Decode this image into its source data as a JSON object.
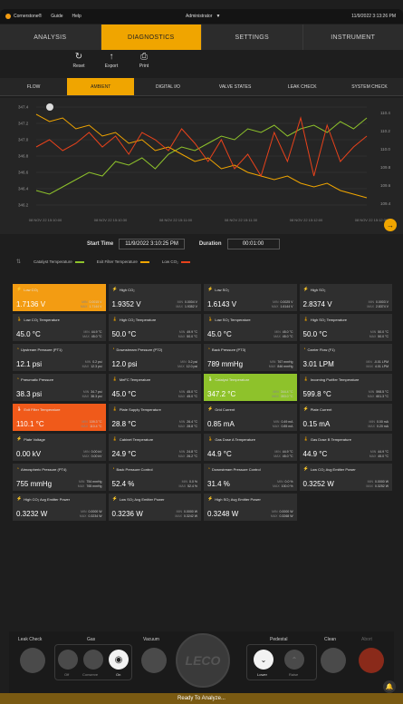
{
  "topbar": {
    "brand": "Cornerstone®",
    "guide": "Guide",
    "help": "Help",
    "user": "Administrator",
    "datetime": "11/9/2022 3:13:26 PM"
  },
  "main_tabs": [
    "ANALYSIS",
    "DIAGNOSTICS",
    "SETTINGS",
    "INSTRUMENT"
  ],
  "actions": [
    {
      "label": "Reset",
      "icon": "reset-icon",
      "glyph": "↻"
    },
    {
      "label": "Export",
      "icon": "export-icon",
      "glyph": "↑"
    },
    {
      "label": "Print",
      "icon": "print-icon",
      "glyph": "⎙"
    }
  ],
  "sub_tabs": [
    "FLOW",
    "AMBIENT",
    "DIGITAL I/O",
    "VALVE STATES",
    "LEAK CHECK",
    "SYSTEM CHECK"
  ],
  "chart_data": {
    "type": "line",
    "left_axis": [
      "347.4",
      "347.2",
      "347.0",
      "346.8",
      "346.6",
      "346.4",
      "346.2"
    ],
    "right_axis": [
      "110.4",
      "110.2",
      "110.0",
      "109.8",
      "109.6",
      "109.4"
    ],
    "x_labels": [
      "08 NOV 22 15:10:00",
      "08 NOV 22 15:10:30",
      "08 NOV 22 15:11:00",
      "08 NOV 22 15:11:30",
      "08 NOV 22 15:12:00",
      "08 NOV 22 15:12:30"
    ],
    "series": [
      {
        "name": "Catalyst Temperature",
        "color": "#8ec22b",
        "values": [
          346.3,
          346.25,
          346.35,
          346.45,
          346.55,
          346.5,
          346.7,
          346.65,
          346.75,
          346.6,
          346.8,
          346.9,
          346.85,
          346.95,
          347.05,
          347.0,
          347.15,
          347.1,
          347.2,
          347.05,
          347.15,
          347.2,
          347.1,
          347.25,
          347.15,
          347.3
        ]
      },
      {
        "name": "Exit Filter Temperature",
        "color": "#f0a500",
        "values": [
          347.35,
          347.25,
          347.3,
          347.15,
          347.2,
          347.05,
          347.1,
          346.95,
          347.0,
          346.85,
          346.9,
          346.8,
          346.7,
          346.75,
          346.6,
          346.65,
          346.55,
          346.5,
          346.45,
          346.5,
          346.4,
          346.35,
          346.4,
          346.3,
          346.25,
          346.2
        ]
      },
      {
        "name": "Low CO₂",
        "color": "#e8421b",
        "values": [
          346.9,
          347.0,
          346.85,
          346.95,
          347.1,
          346.9,
          347.05,
          346.8,
          347.1,
          347.0,
          346.85,
          347.15,
          346.95,
          346.7,
          347.0,
          346.6,
          346.8,
          346.5,
          347.1,
          346.7,
          347.3,
          346.5,
          347.2,
          346.7,
          346.9,
          347.05
        ]
      }
    ]
  },
  "time_row": {
    "start_label": "Start Time",
    "start_value": "11/9/2022 3:10:25 PM",
    "duration_label": "Duration",
    "duration_value": "00:01:00"
  },
  "tiles": [
    {
      "name": "Low CO₂",
      "value": "1.7136 V",
      "min": "0.0015 V",
      "max": "1.7144 V",
      "state": "orange",
      "icon": "bolt"
    },
    {
      "name": "High CO₂",
      "value": "1.9352 V",
      "min": "0.0004 V",
      "max": "1.9352 V",
      "state": "",
      "icon": "bolt"
    },
    {
      "name": "Low SO₂",
      "value": "1.6143 V",
      "min": "0.0025 V",
      "max": "1.6144 V",
      "state": "",
      "icon": "bolt"
    },
    {
      "name": "High SO₂",
      "value": "2.8374 V",
      "min": "0.0003 V",
      "max": "2.8374 V",
      "state": "",
      "icon": "bolt"
    },
    {
      "name": "Low CO₂ Temperature",
      "value": "45.0 °C",
      "min": "44.9 °C",
      "max": "45.0 °C",
      "state": "",
      "icon": "therm"
    },
    {
      "name": "High CO₂ Temperature",
      "value": "50.0 °C",
      "min": "49.9 °C",
      "max": "50.0 °C",
      "state": "",
      "icon": "therm"
    },
    {
      "name": "Low SO₂ Temperature",
      "value": "45.0 °C",
      "min": "45.0 °C",
      "max": "45.0 °C",
      "state": "",
      "icon": "therm"
    },
    {
      "name": "High SO₂ Temperature",
      "value": "50.0 °C",
      "min": "50.0 °C",
      "max": "50.0 °C",
      "state": "",
      "icon": "therm"
    },
    {
      "name": "Upstream Pressure (PT1)",
      "value": "12.1 psi",
      "min": "0.2 psi",
      "max": "12.3 psi",
      "state": "",
      "icon": "gauge"
    },
    {
      "name": "Downstream Pressure (PT2)",
      "value": "12.0 psi",
      "min": "0.2 psi",
      "max": "12.0 psi",
      "state": "",
      "icon": "gauge"
    },
    {
      "name": "Back Pressure (PT3)",
      "value": "789 mmHg",
      "min": "767 mmHg",
      "max": "846 mmHg",
      "state": "",
      "icon": "gauge"
    },
    {
      "name": "Carrier Flow (F1)",
      "value": "3.01 LPM",
      "min": "-0.01 LPM",
      "max": "4.01 LPM",
      "state": "",
      "icon": "gauge"
    },
    {
      "name": "Pneumatic Pressure",
      "value": "38.3 psi",
      "min": "34.7 psi",
      "max": "38.3 psi",
      "state": "",
      "icon": "gauge"
    },
    {
      "name": "MeFC Temperature",
      "value": "45.0 °C",
      "min": "45.0 °C",
      "max": "45.0 °C",
      "state": "",
      "icon": "therm"
    },
    {
      "name": "Catalyst Temperature",
      "value": "347.2 °C",
      "min": "344.4 °C",
      "max": "353.0 °C",
      "state": "green",
      "icon": "therm"
    },
    {
      "name": "Incoming Purifier Temperature",
      "value": "599.8 °C",
      "min": "598.5 °C",
      "max": "601.3 °C",
      "state": "",
      "icon": "therm"
    },
    {
      "name": "Exit Filter Temperature",
      "value": "110.1 °C",
      "min": "109.3 °C",
      "max": "110.4 °C",
      "state": "red",
      "icon": "therm"
    },
    {
      "name": "Plate Supply Temperature",
      "value": "28.8 °C",
      "min": "26.4 °C",
      "max": "28.8 °C",
      "state": "",
      "icon": "therm"
    },
    {
      "name": "Grid Current",
      "value": "0.85 mA",
      "min": "0.49 mA",
      "max": "0.85 mA",
      "state": "",
      "icon": "bolt"
    },
    {
      "name": "Plate Current",
      "value": "0.15 mA",
      "min": "0.00 mA",
      "max": "0.20 mA",
      "state": "",
      "icon": "bolt"
    },
    {
      "name": "Plate Voltage",
      "value": "0.00 kV",
      "min": "0.00 kV",
      "max": "0.00 kV",
      "state": "",
      "icon": "bolt"
    },
    {
      "name": "Cabinet Temperature",
      "value": "24.9 °C",
      "min": "24.8 °C",
      "max": "26.2 °C",
      "state": "",
      "icon": "therm"
    },
    {
      "name": "Gas Dose A Temperature",
      "value": "44.9 °C",
      "min": "44.9 °C",
      "max": "45.0 °C",
      "state": "",
      "icon": "therm"
    },
    {
      "name": "Gas Dose B Temperature",
      "value": "44.9 °C",
      "min": "44.9 °C",
      "max": "45.0 °C",
      "state": "",
      "icon": "therm"
    },
    {
      "name": "Atmospheric Pressure (PT4)",
      "value": "755 mmHg",
      "min": "754 mmHg",
      "max": "765 mmHg",
      "state": "",
      "icon": "gauge"
    },
    {
      "name": "Back Pressure Control",
      "value": "52.4 %",
      "min": "0.0 %",
      "max": "52.4 %",
      "state": "",
      "icon": "gauge"
    },
    {
      "name": "Downstream Pressure Control",
      "value": "31.4 %",
      "min": "0.0 %",
      "max": "100.0 %",
      "state": "",
      "icon": "gauge"
    },
    {
      "name": "Low CO₂ Avg Emitter Power",
      "value": "0.3252 W",
      "min": "0.0000 W",
      "max": "0.3252 W",
      "state": "",
      "icon": "bolt"
    },
    {
      "name": "High CO₂ Avg Emitter Power",
      "value": "0.3232 W",
      "min": "0.0000 W",
      "max": "0.3234 W",
      "state": "",
      "icon": "bolt"
    },
    {
      "name": "Low SO₂ Avg Emitter Power",
      "value": "0.3236 W",
      "min": "0.0000 W",
      "max": "0.3242 W",
      "state": "",
      "icon": "bolt"
    },
    {
      "name": "High SO₂ Avg Emitter Power",
      "value": "0.3248 W",
      "min": "0.0000 W",
      "max": "0.3268 W",
      "state": "",
      "icon": "bolt"
    }
  ],
  "minmax_labels": {
    "min": "MIN",
    "max": "MAX"
  },
  "controls": {
    "leak_check": "Leak Check",
    "gas": "Gas",
    "gas_off": "Off",
    "gas_conserve": "Conserve",
    "gas_on": "On",
    "vacuum": "Vacuum",
    "logo": "LECO",
    "pedestal": "Pedestal",
    "lower": "Lower",
    "raise": "Raise",
    "clean": "Clean",
    "abort": "Abort"
  },
  "status": "Ready To Analyze..."
}
